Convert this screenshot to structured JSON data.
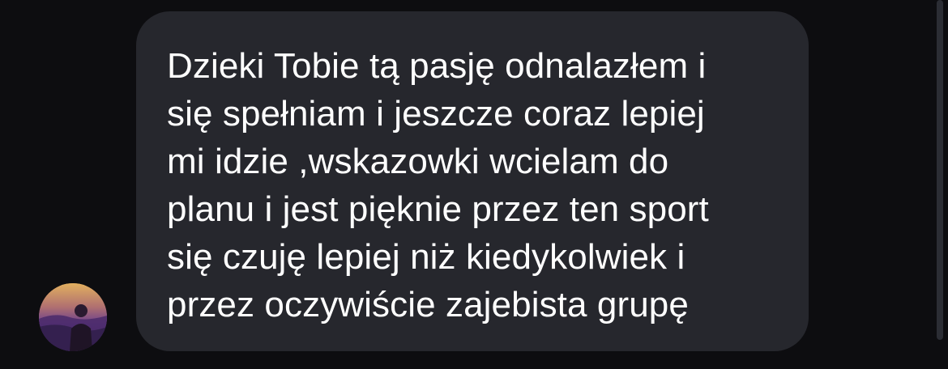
{
  "conversation": {
    "message": {
      "lines": [
        "Dzieki Tobie tą pasję odnalazłem i",
        "się spełniam i jeszcze coraz lepiej",
        "mi idzie ,wskazowki wcielam do",
        "planu i jest pięknie przez ten sport",
        "się czuję lepiej niż kiedykolwiek i",
        "przez oczywiście zajebista grupę"
      ]
    },
    "sender": {
      "avatar_icon": "profile-photo"
    }
  },
  "colors": {
    "background": "#0d0d10",
    "bubble": "#26272d",
    "text": "#ffffff",
    "scrollbar": "#2b2d34"
  }
}
